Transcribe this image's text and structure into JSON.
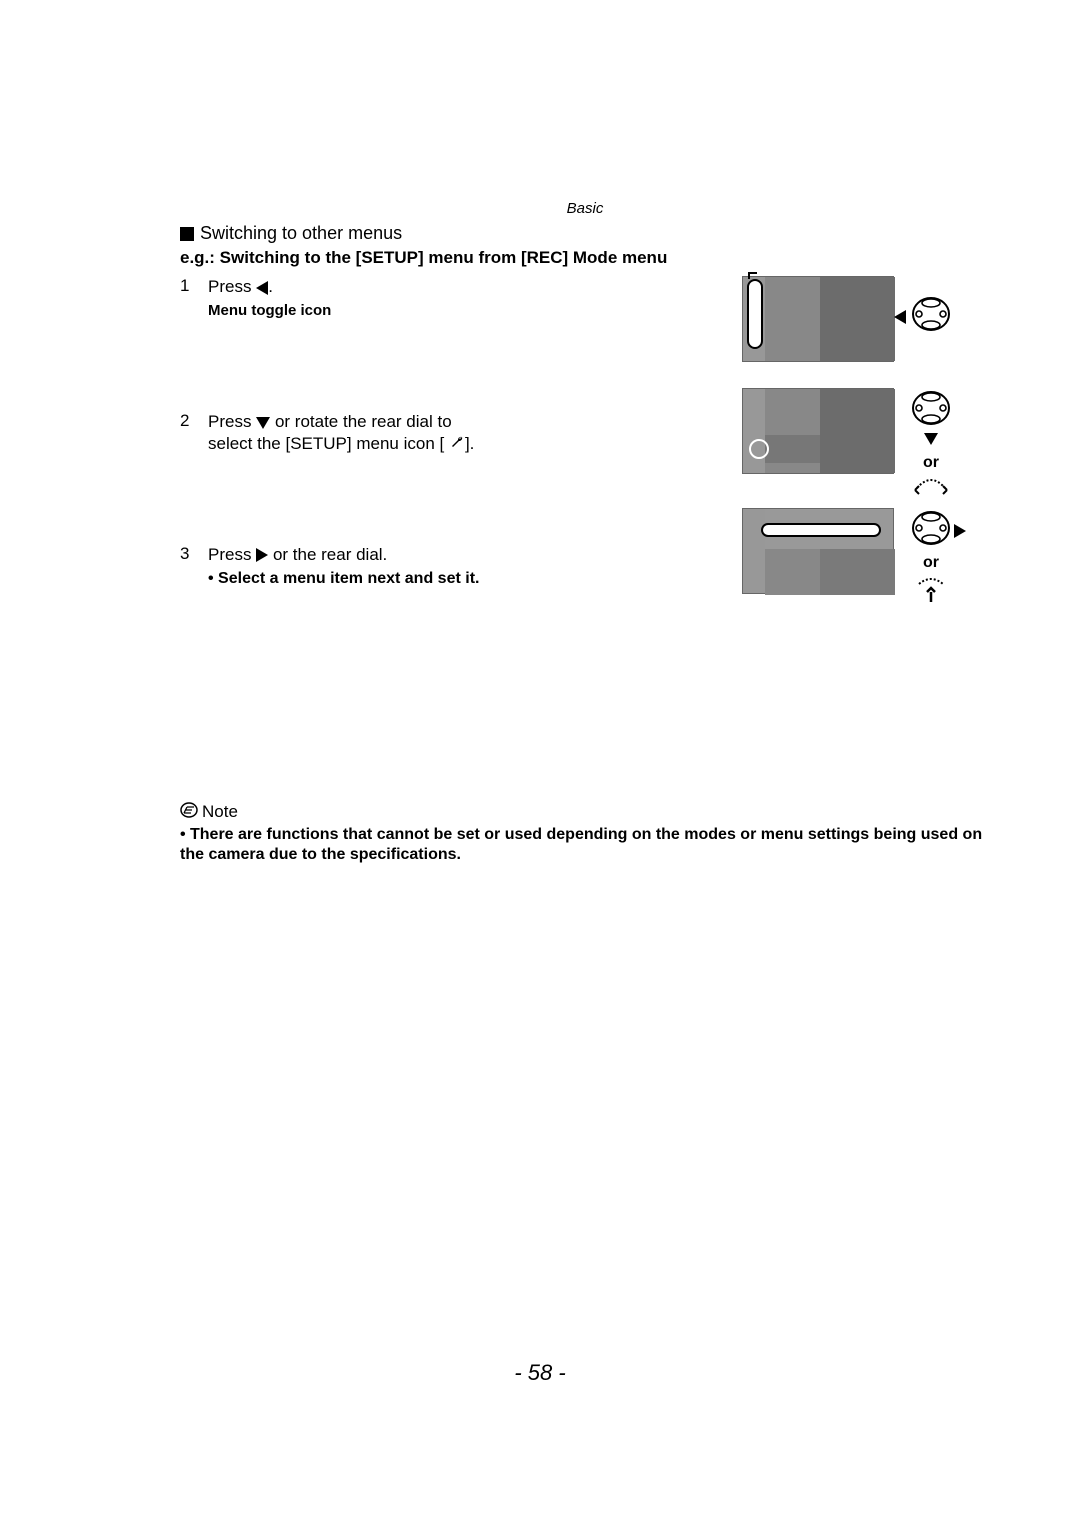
{
  "header": {
    "section": "Basic"
  },
  "subheading": "Switching to other menus",
  "example_line": "e.g.: Switching to the [SETUP] menu from [REC] Mode menu",
  "steps": {
    "s1": {
      "num": "1",
      "press": "Press",
      "dot": ".",
      "menu_toggle": "Menu toggle icon"
    },
    "s2": {
      "num": "2",
      "press": "Press",
      "line_rest": "or rotate the rear dial to",
      "line2a": "select the [SETUP] menu icon [",
      "line2b": "]."
    },
    "s3": {
      "num": "3",
      "press": "Press",
      "rest": "or the rear dial.",
      "detail": "• Select a menu item next and set it."
    }
  },
  "illus": {
    "or1": "or",
    "or2": "or"
  },
  "note": {
    "label": "Note",
    "text": "There are functions that cannot be set or used depending on the modes or menu settings being used on the camera due to the specifications."
  },
  "page_number": "- 58 -"
}
